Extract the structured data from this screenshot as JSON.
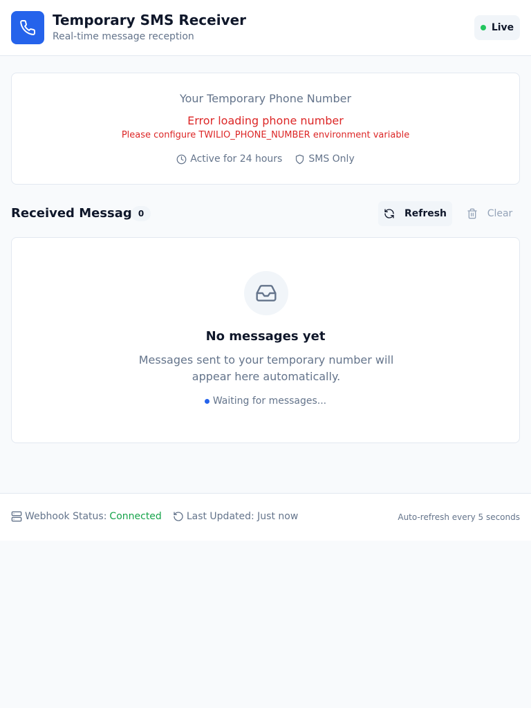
{
  "header": {
    "title": "Temporary SMS Receiver",
    "subtitle": "Real-time message reception",
    "status_label": "Live",
    "app_icon": "phone-icon"
  },
  "phone_card": {
    "title": "Your Temporary Phone Number",
    "error": "Error loading phone number",
    "error_detail": "Please configure TWILIO_PHONE_NUMBER environment variable",
    "duration": "Active for 24 hours",
    "type": "SMS Only"
  },
  "messages": {
    "title": "Received Messages",
    "count": "0",
    "refresh_label": "Refresh",
    "clear_label": "Clear",
    "empty_title": "No messages yet",
    "empty_description": "Messages sent to your temporary number will appear here automatically.",
    "waiting_text": "Waiting for messages..."
  },
  "footer": {
    "webhook_label": "Webhook Status:",
    "webhook_value": "Connected",
    "last_updated": "Last Updated: Just now",
    "auto_refresh": "Auto-refresh every 5 seconds"
  },
  "colors": {
    "primary": "#2563eb",
    "live": "#22c55e",
    "error": "#dc2626",
    "connected": "#16a34a"
  }
}
